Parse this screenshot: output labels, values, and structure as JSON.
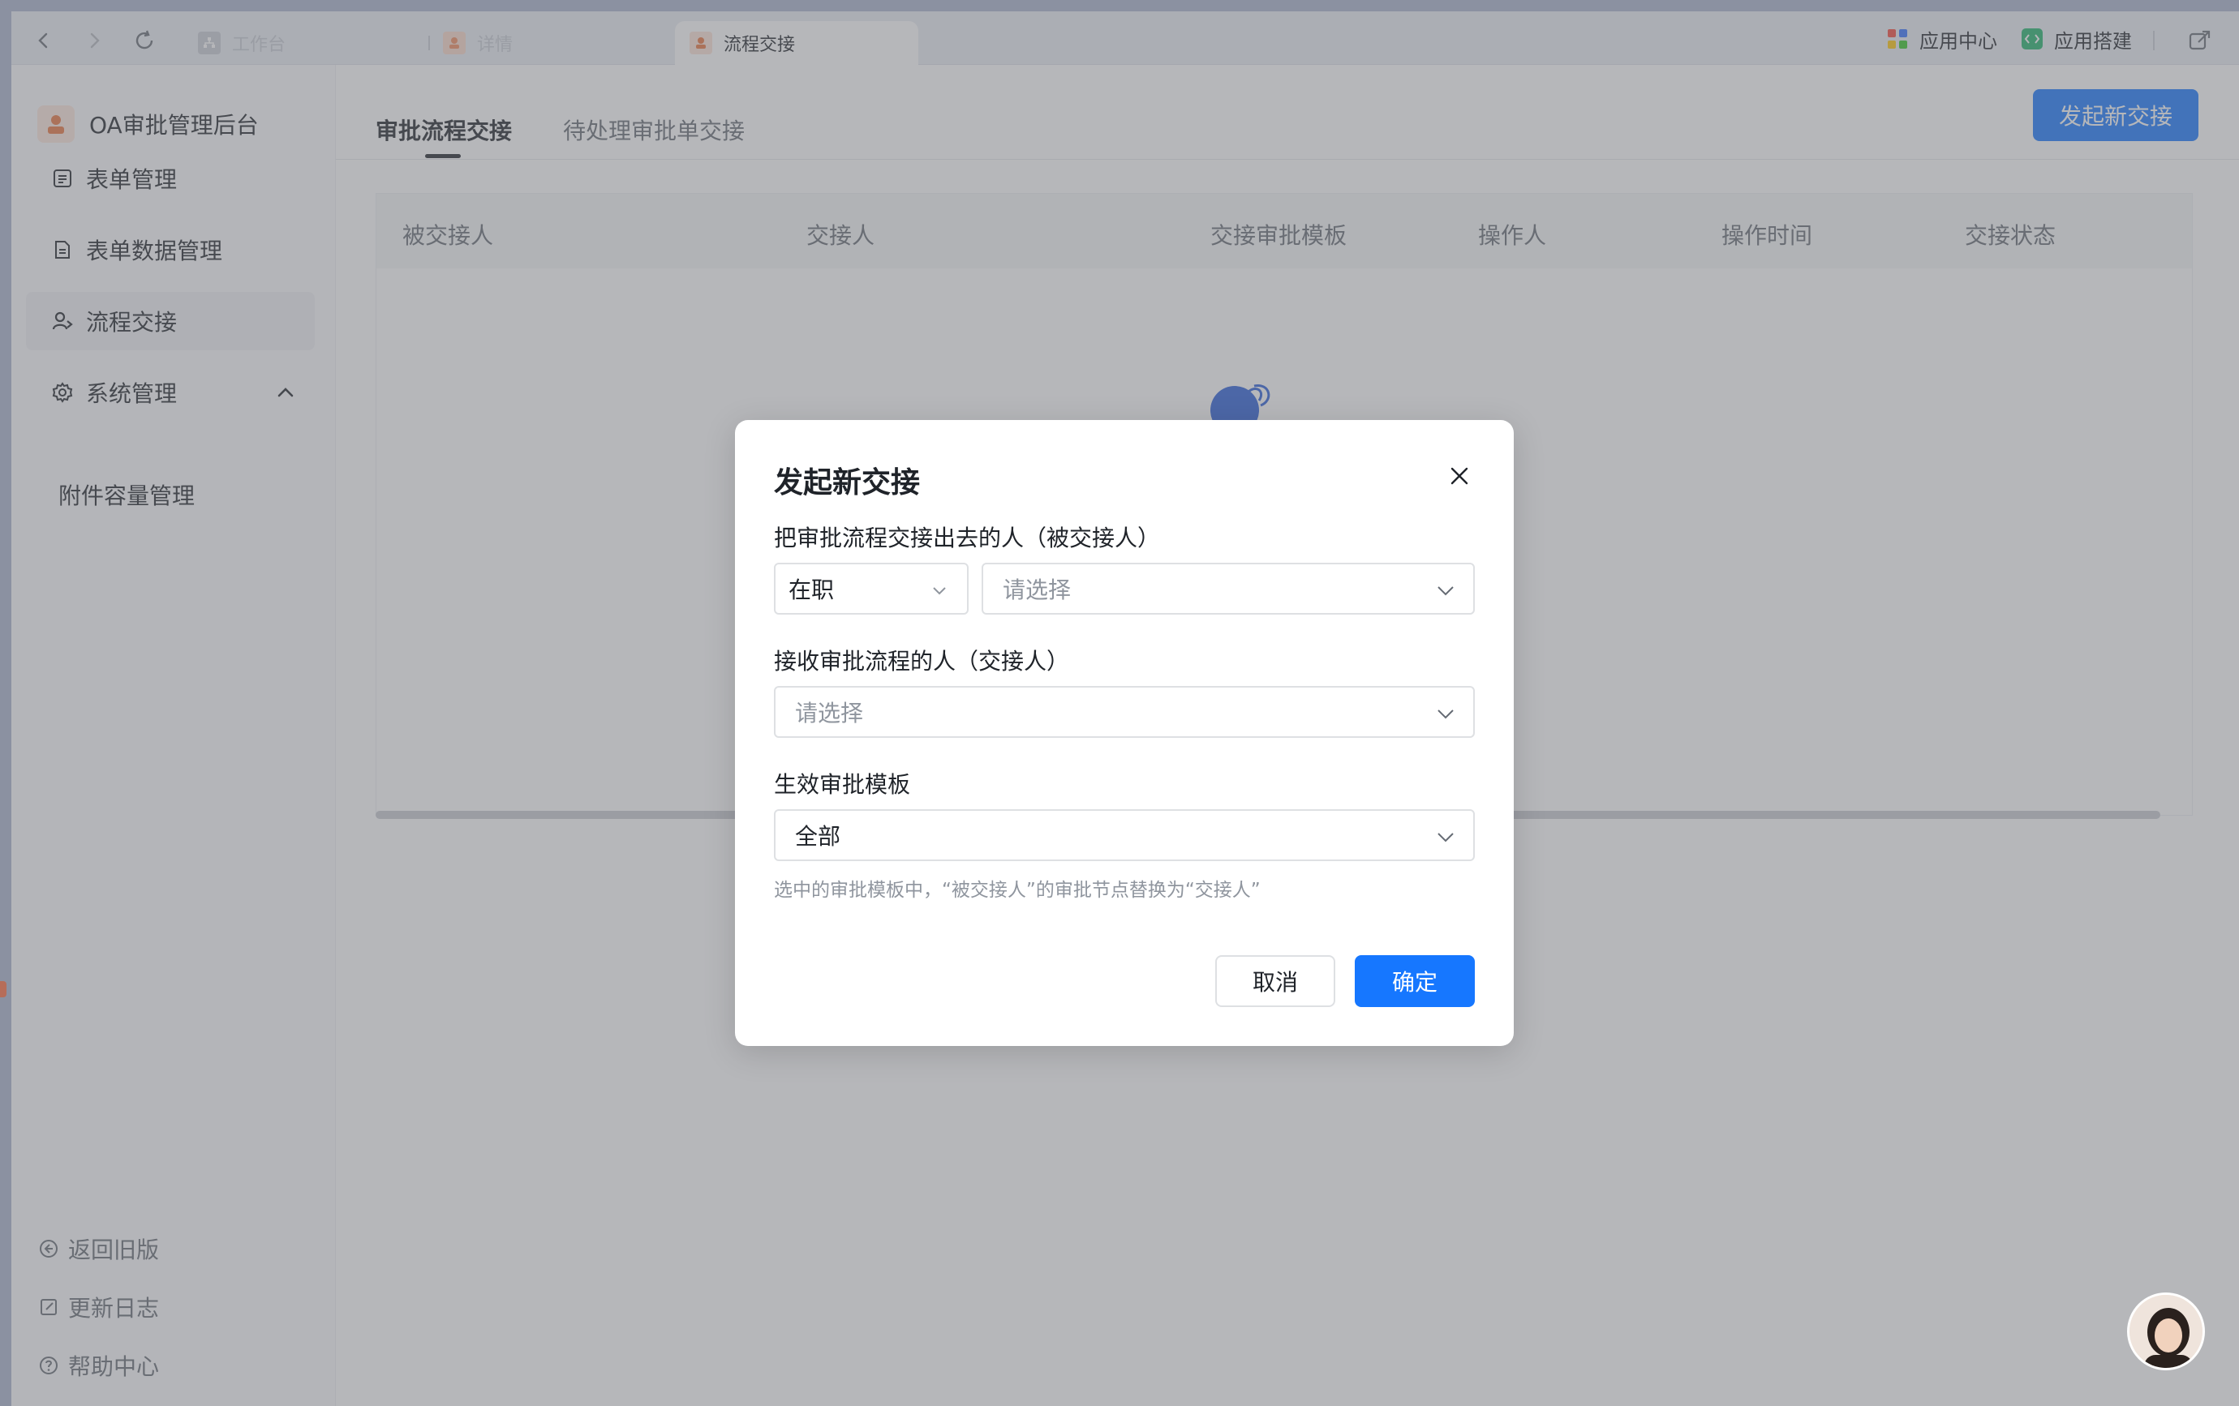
{
  "tabbar": {
    "tabs": [
      {
        "label": "工作台",
        "icon": "org-chart-icon",
        "active": false
      },
      {
        "label": "详情",
        "icon": "approval-app-icon",
        "active": false
      },
      {
        "label": "流程交接",
        "icon": "approval-app-icon",
        "active": true
      }
    ],
    "app_center": "应用中心",
    "app_builder": "应用搭建"
  },
  "sidebar": {
    "brand": "OA审批管理后台",
    "items": [
      {
        "label": "表单管理",
        "icon": "form-icon"
      },
      {
        "label": "表单数据管理",
        "icon": "form-data-icon"
      },
      {
        "label": "流程交接",
        "icon": "handover-icon",
        "active": true
      },
      {
        "label": "系统管理",
        "icon": "gear-icon",
        "expanded": true
      }
    ],
    "sub_items": [
      "附件容量管理"
    ],
    "footer": [
      {
        "label": "返回旧版",
        "icon": "back-circle-icon"
      },
      {
        "label": "更新日志",
        "icon": "changelog-icon"
      },
      {
        "label": "帮助中心",
        "icon": "help-icon"
      }
    ]
  },
  "main": {
    "tabs": [
      "审批流程交接",
      "待处理审批单交接"
    ],
    "new_button": "发起新交接",
    "columns": [
      "被交接人",
      "交接人",
      "交接审批模板",
      "操作人",
      "操作时间",
      "交接状态"
    ]
  },
  "modal": {
    "title": "发起新交接",
    "field1_label": "把审批流程交接出去的人（被交接人）",
    "status_select": "在职",
    "person_placeholder": "请选择",
    "field2_label": "接收审批流程的人（交接人）",
    "receiver_placeholder": "请选择",
    "field3_label": "生效审批模板",
    "template_value": "全部",
    "hint": "选中的审批模板中，“被交接人”的审批节点替换为“交接人”",
    "cancel": "取消",
    "confirm": "确定"
  },
  "colors": {
    "primary": "#1677ff",
    "overlay": "rgba(110,112,118,0.5)"
  }
}
